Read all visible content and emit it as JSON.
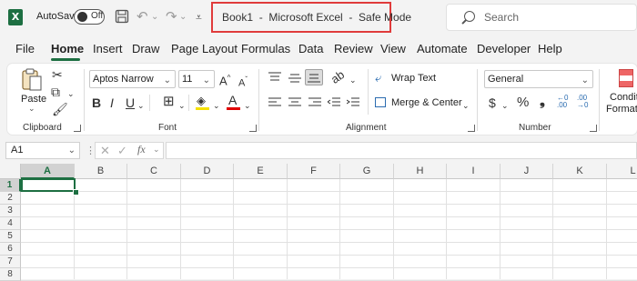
{
  "titlebar": {
    "autosave_label": "AutoSave",
    "autosave_state": "Off",
    "title": "Book1  -  Microsoft Excel  -  Safe Mode",
    "search_placeholder": "Search"
  },
  "menu": {
    "tabs": [
      "File",
      "Home",
      "Insert",
      "Draw",
      "Page Layout",
      "Formulas",
      "Data",
      "Review",
      "View",
      "Automate",
      "Developer",
      "Help"
    ],
    "active": "Home"
  },
  "ribbon": {
    "clipboard": {
      "paste_label": "Paste",
      "group_label": "Clipboard"
    },
    "font": {
      "font_name": "Aptos Narrow",
      "font_size": "11",
      "group_label": "Font"
    },
    "alignment": {
      "wrap_text": "Wrap Text",
      "merge_center": "Merge & Center",
      "group_label": "Alignment"
    },
    "number": {
      "format": "General",
      "group_label": "Number"
    },
    "styles": {
      "cond_line1": "Conditi",
      "cond_line2": "Formatt"
    }
  },
  "formula_bar": {
    "name_box": "A1",
    "fx_label": "fx",
    "formula": ""
  },
  "grid": {
    "columns": [
      "A",
      "B",
      "C",
      "D",
      "E",
      "F",
      "G",
      "H",
      "I",
      "J",
      "K",
      "L"
    ],
    "rows": [
      "1",
      "2",
      "3",
      "4",
      "5",
      "6",
      "7",
      "8"
    ],
    "active_cell": "A1"
  },
  "colors": {
    "accent": "#1d6f42",
    "title_highlight": "#e03b3b"
  }
}
